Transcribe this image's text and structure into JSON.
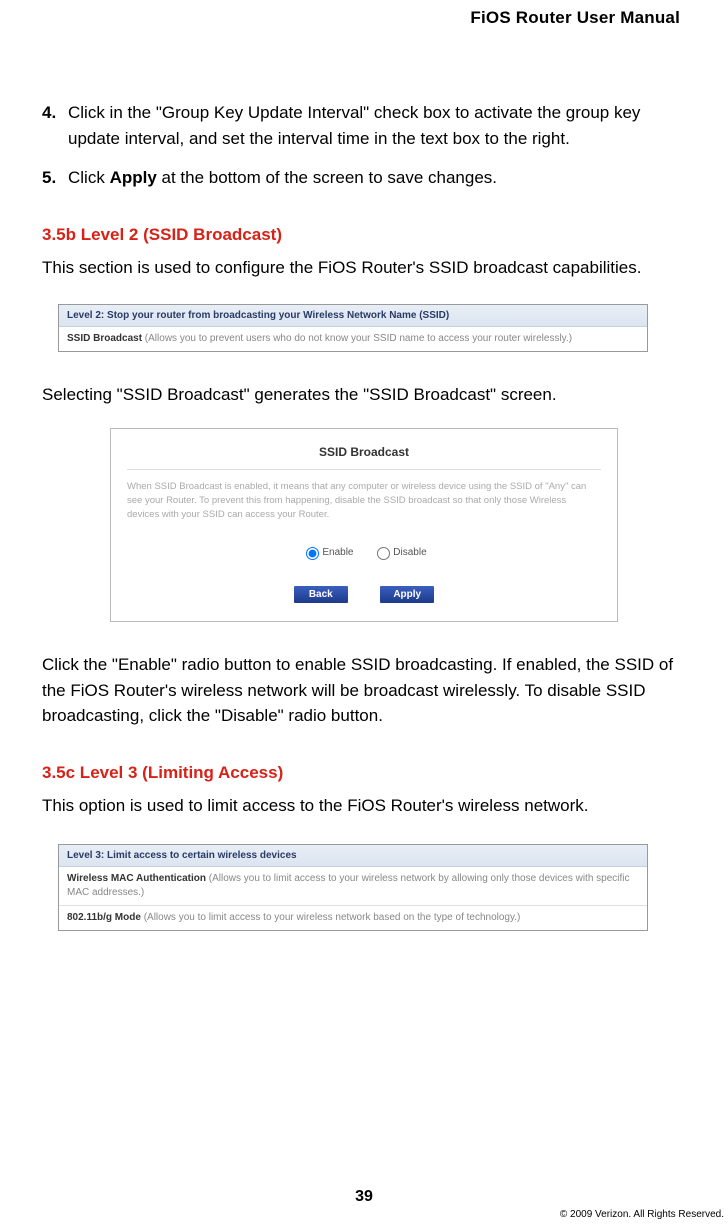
{
  "header": {
    "manual_title": "FiOS Router User Manual"
  },
  "steps": {
    "s4": {
      "num": "4.",
      "text_a": "Click in the \"Group Key Update Interval\" check box to activate the group key update interval, and set the interval time in the text box to the right."
    },
    "s5": {
      "num": "5.",
      "text_a": "Click ",
      "bold": "Apply",
      "text_b": " at the bottom of the screen to save changes."
    }
  },
  "sec35b": {
    "heading": "3.5b  Level 2 (SSID Broadcast)",
    "intro": "This section is used to configure the FiOS Router's SSID broadcast capabilities.",
    "fig_header": "Level 2: Stop your router from broadcasting your Wireless Network Name (SSID)",
    "fig_row_title": "SSID Broadcast",
    "fig_row_desc": " (Allows you to prevent users who do not know your SSID name to access your router wirelessly.)",
    "middle_para": " Selecting \"SSID Broadcast\" generates the \"SSID Broadcast\" screen.",
    "fig2": {
      "title": "SSID Broadcast",
      "desc": "When SSID Broadcast is enabled, it means that any computer or wireless device using the SSID of \"Any\" can see your Router. To prevent this from happening, disable the SSID broadcast so that only those Wireless devices with your SSID can access your Router.",
      "opt_enable": "Enable",
      "opt_disable": "Disable",
      "btn_back": "Back",
      "btn_apply": "Apply"
    },
    "after_fig2": "Click the \"Enable\" radio button to enable SSID broadcasting. If enabled, the SSID of the FiOS Router's wireless network will be broadcast wirelessly. To disable SSID broadcasting, click the \"Disable\" radio button."
  },
  "sec35c": {
    "heading": "3.5c  Level 3 (Limiting Access)",
    "intro": "This option is used to limit access to the FiOS Router's wireless network.",
    "fig_header": "Level 3: Limit access to certain wireless devices",
    "row1_title": "Wireless MAC Authentication",
    "row1_desc": " (Allows you to limit access to your wireless network by allowing only those devices with specific MAC addresses.)",
    "row2_title": "802.11b/g Mode",
    "row2_desc": " (Allows you to limit access to your wireless network based on the type of technology.)"
  },
  "footer": {
    "page_num": "39",
    "copyright": "© 2009 Verizon. All Rights Reserved."
  }
}
